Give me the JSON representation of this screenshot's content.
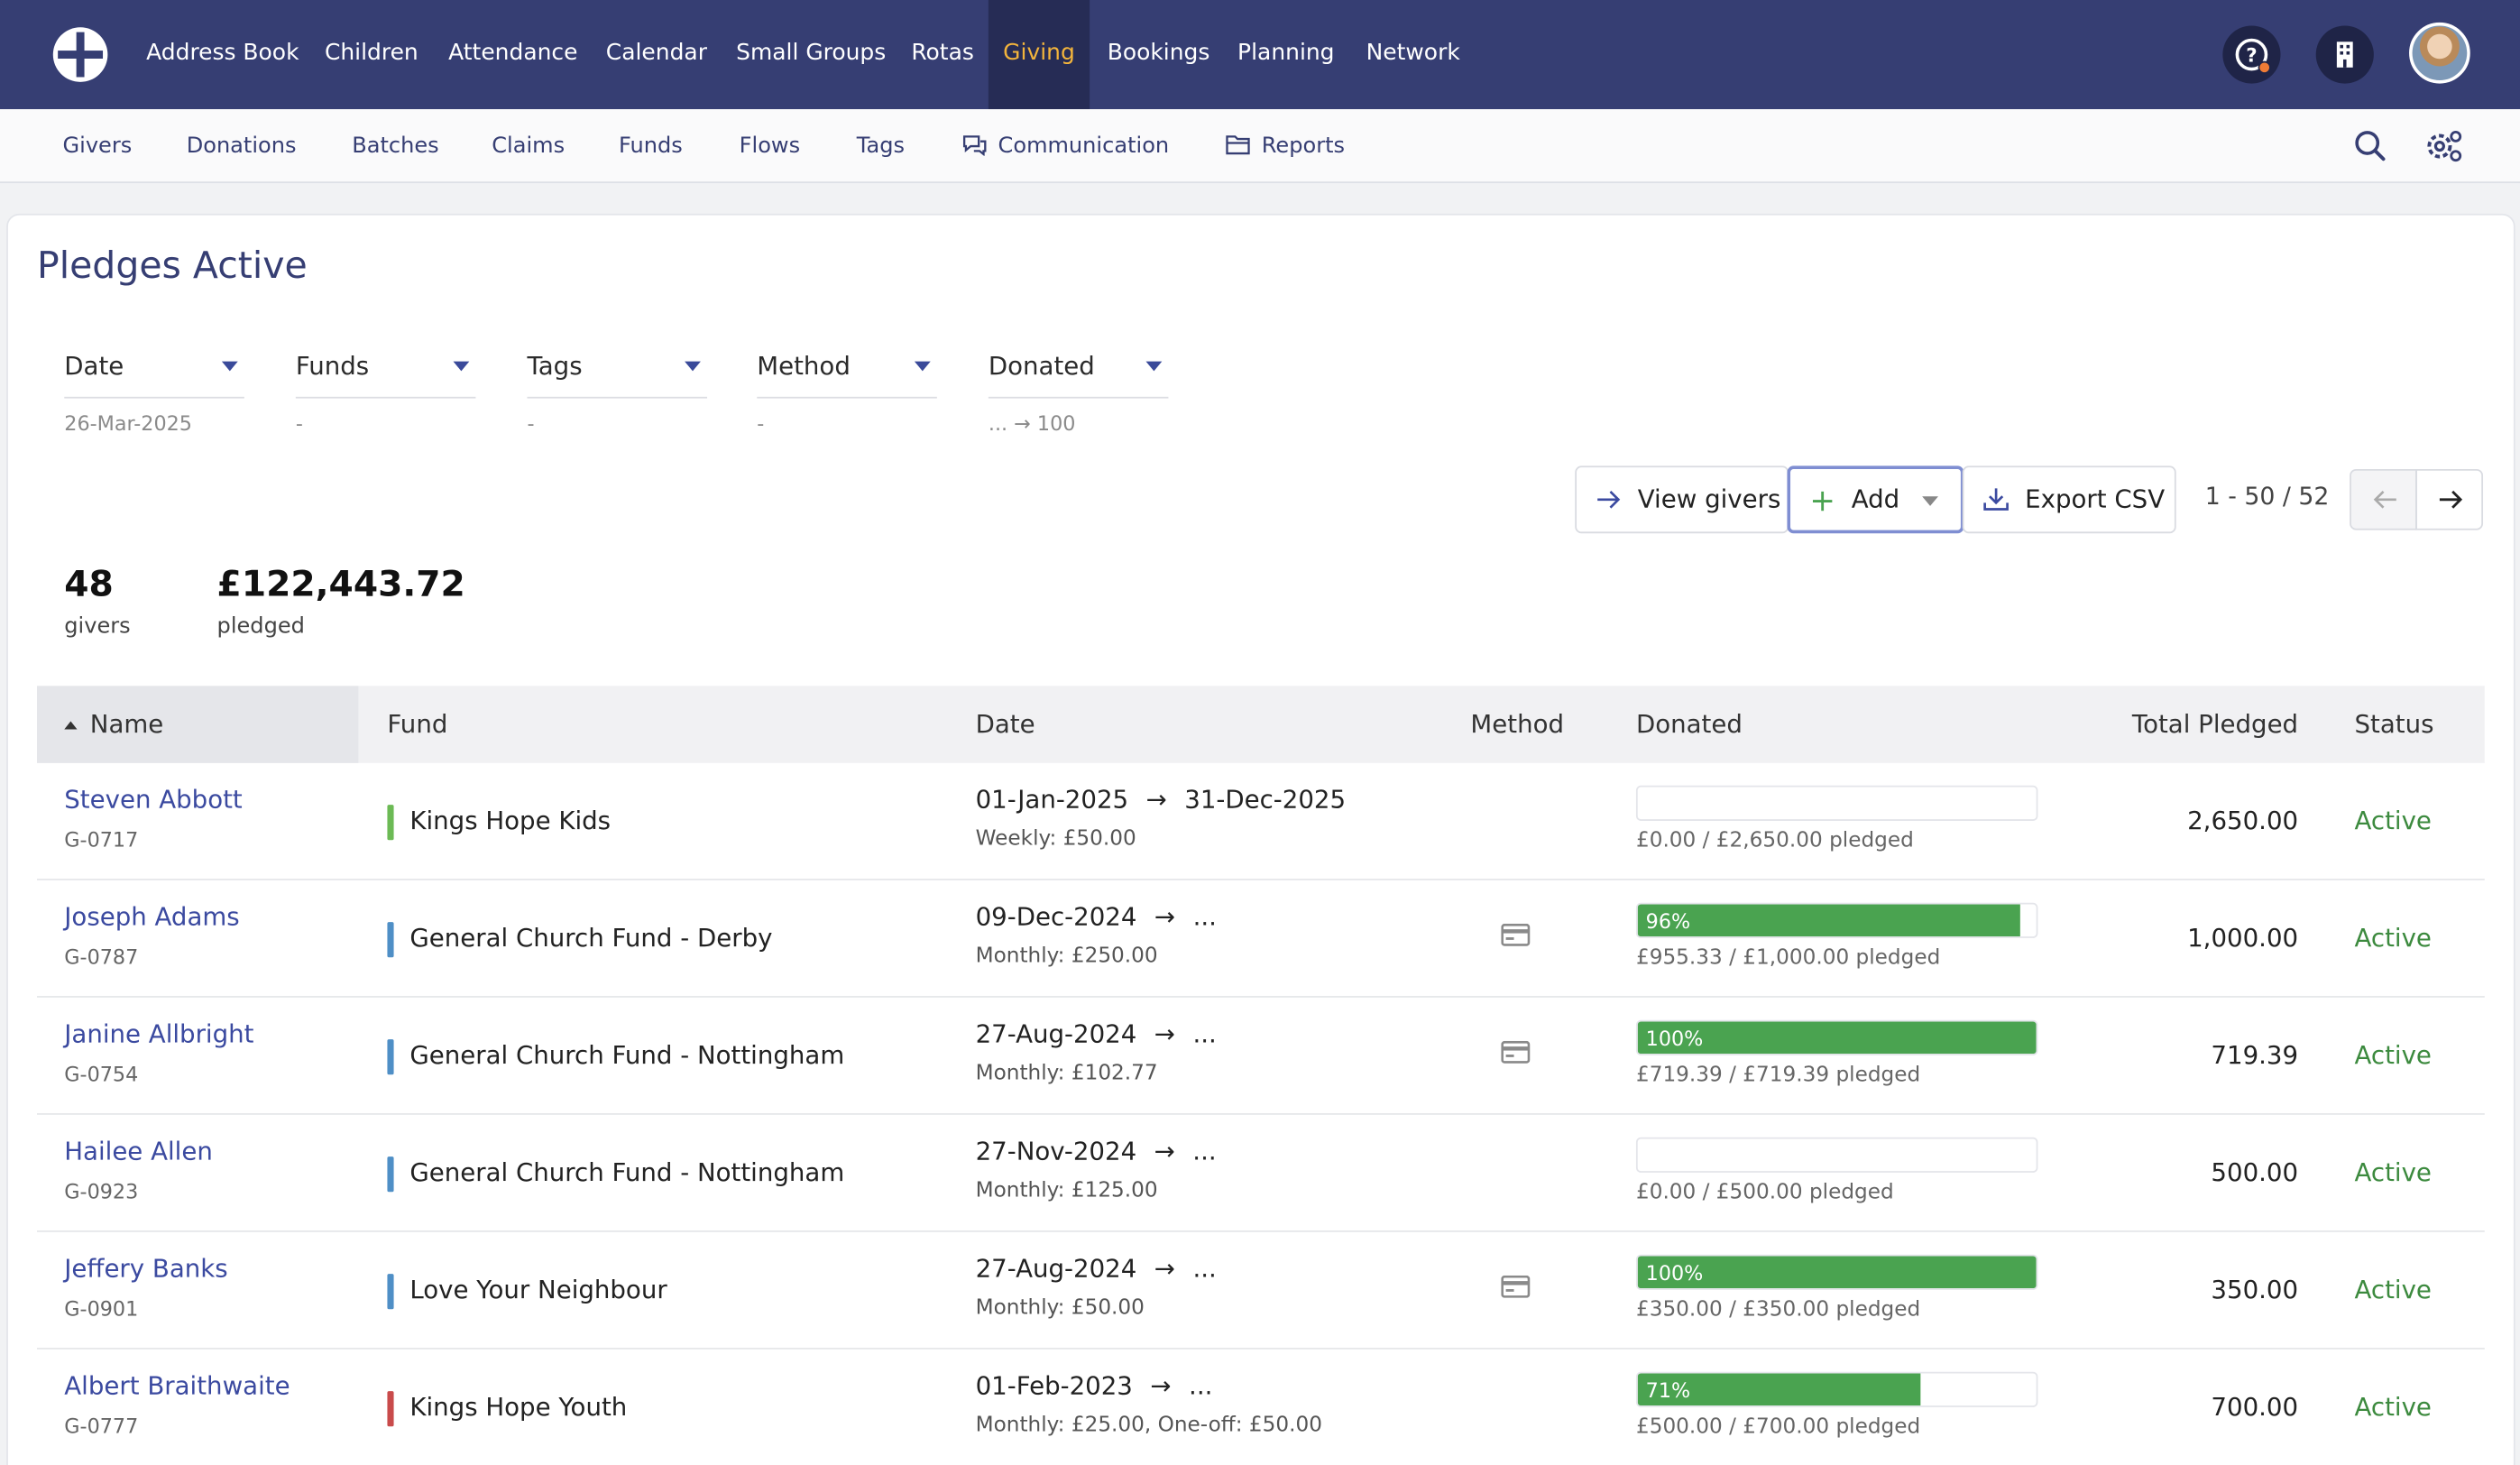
{
  "topnav": {
    "items": [
      "Address Book",
      "Children",
      "Attendance",
      "Calendar",
      "Small Groups",
      "Rotas",
      "Giving",
      "Bookings",
      "Planning",
      "Network"
    ],
    "active": "Giving",
    "accent_color": "#f2b43c",
    "bg_color": "#363e73"
  },
  "subnav": {
    "items": [
      "Givers",
      "Donations",
      "Batches",
      "Claims",
      "Funds",
      "Flows",
      "Tags",
      "Communication",
      "Reports"
    ]
  },
  "page": {
    "title": "Pledges Active"
  },
  "filters": [
    {
      "label": "Date",
      "value": "26-Mar-2025"
    },
    {
      "label": "Funds",
      "value": "-"
    },
    {
      "label": "Tags",
      "value": "-"
    },
    {
      "label": "Method",
      "value": "-"
    },
    {
      "label": "Donated",
      "value": "... → 100"
    }
  ],
  "actions": {
    "view_givers": "View givers",
    "add": "Add",
    "export_csv": "Export CSV",
    "pager": "1 - 50 / 52"
  },
  "stats": {
    "givers_count": "48",
    "givers_label": "givers",
    "pledged_amount": "£122,443.72",
    "pledged_label": "pledged"
  },
  "table": {
    "headers": [
      "Name",
      "Fund",
      "Date",
      "Method",
      "Donated",
      "Total Pledged",
      "Status"
    ],
    "rows": [
      {
        "name": "Steven Abbott",
        "id": "G-0717",
        "fund": "Kings Hope Kids",
        "fund_color": "#6cba55",
        "date": "01-Jan-2025",
        "date_end": "31-Dec-2025",
        "schedule": "Weekly: £50.00",
        "method": "",
        "percent": 0,
        "percent_label": "",
        "donated": "£0.00 / £2,650.00 pledged",
        "total": "2,650.00",
        "status": "Active"
      },
      {
        "name": "Joseph Adams",
        "id": "G-0787",
        "fund": "General Church Fund - Derby",
        "fund_color": "#4f8fc6",
        "date": "09-Dec-2024",
        "date_end": "...",
        "schedule": "Monthly: £250.00",
        "method": "card",
        "percent": 96,
        "percent_label": "96%",
        "donated": "£955.33 / £1,000.00 pledged",
        "total": "1,000.00",
        "status": "Active"
      },
      {
        "name": "Janine Allbright",
        "id": "G-0754",
        "fund": "General Church Fund - Nottingham",
        "fund_color": "#4f8fc6",
        "date": "27-Aug-2024",
        "date_end": "...",
        "schedule": "Monthly: £102.77",
        "method": "card",
        "percent": 100,
        "percent_label": "100%",
        "donated": "£719.39 / £719.39 pledged",
        "total": "719.39",
        "status": "Active"
      },
      {
        "name": "Hailee Allen",
        "id": "G-0923",
        "fund": "General Church Fund - Nottingham",
        "fund_color": "#4f8fc6",
        "date": "27-Nov-2024",
        "date_end": "...",
        "schedule": "Monthly: £125.00",
        "method": "",
        "percent": 0,
        "percent_label": "",
        "donated": "£0.00 / £500.00 pledged",
        "total": "500.00",
        "status": "Active"
      },
      {
        "name": "Jeffery Banks",
        "id": "G-0901",
        "fund": "Love Your Neighbour",
        "fund_color": "#4f8fc6",
        "date": "27-Aug-2024",
        "date_end": "...",
        "schedule": "Monthly: £50.00",
        "method": "card",
        "percent": 100,
        "percent_label": "100%",
        "donated": "£350.00 / £350.00 pledged",
        "total": "350.00",
        "status": "Active"
      },
      {
        "name": "Albert Braithwaite",
        "id": "G-0777",
        "fund": "Kings Hope Youth",
        "fund_color": "#c94b4b",
        "date": "01-Feb-2023",
        "date_end": "...",
        "schedule": "Monthly: £25.00, One-off: £50.00",
        "method": "",
        "percent": 71,
        "percent_label": "71%",
        "donated": "£500.00 / £700.00 pledged",
        "total": "700.00",
        "status": "Active"
      }
    ]
  }
}
